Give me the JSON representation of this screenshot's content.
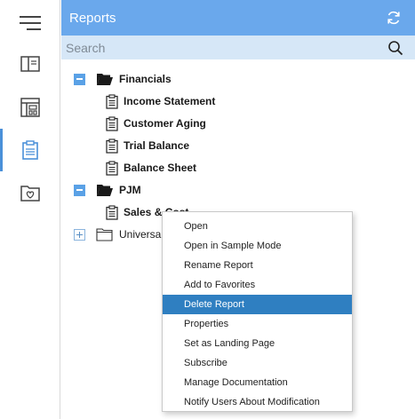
{
  "rail": {
    "items": [
      {
        "name": "menu",
        "active": false
      },
      {
        "name": "book",
        "active": false
      },
      {
        "name": "dashboard",
        "active": false
      },
      {
        "name": "reports",
        "active": true
      },
      {
        "name": "favorites",
        "active": false
      }
    ]
  },
  "header": {
    "title": "Reports"
  },
  "search": {
    "placeholder": "Search",
    "value": ""
  },
  "tree": {
    "financials": {
      "label": "Financials",
      "children": [
        "Income Statement",
        "Customer Aging",
        "Trial Balance",
        "Balance Sheet"
      ]
    },
    "pjm": {
      "label": "PJM",
      "children": [
        "Sales & Cost"
      ]
    },
    "universal": {
      "label": "Universal"
    }
  },
  "context_menu": {
    "items": [
      "Open",
      "Open in Sample Mode",
      "Rename Report",
      "Add to Favorites",
      "Delete Report",
      "Properties",
      "Set as Landing Page",
      "Subscribe",
      "Manage Documentation",
      "Notify Users About Modification"
    ],
    "highlighted_index": 4
  },
  "colors": {
    "header_bg": "#6aa8ec",
    "search_bg": "#d6e7f7",
    "accent": "#4a90d9",
    "menu_highlight": "#2f7fc1"
  }
}
